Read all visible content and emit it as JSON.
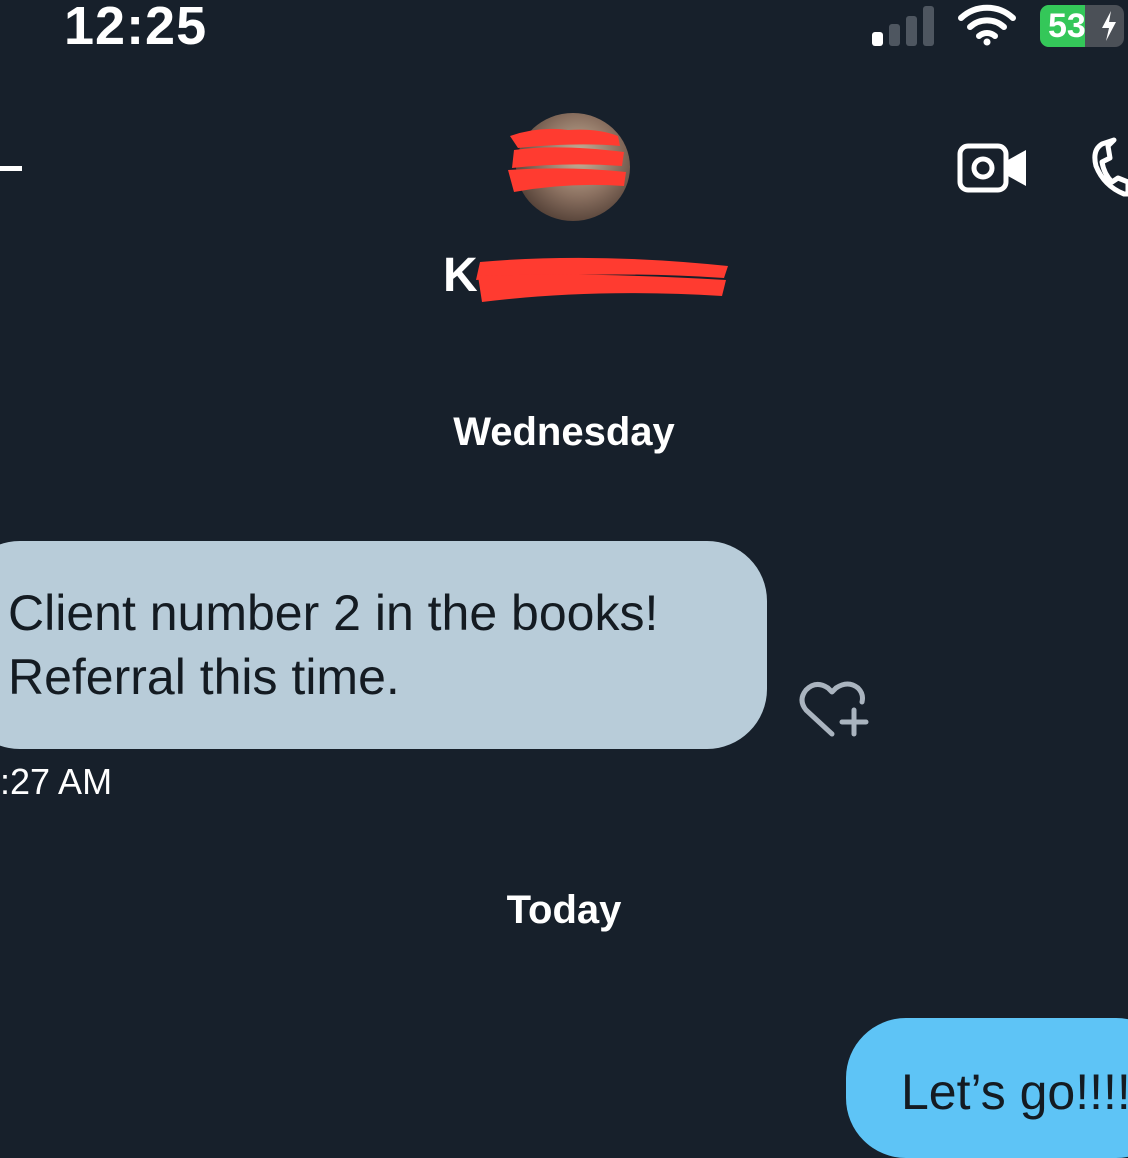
{
  "status_bar": {
    "time": "12:25",
    "battery_percent": "53",
    "signal_strength": 0.25,
    "icons": [
      "signal-icon",
      "wifi-icon",
      "battery-charging-icon"
    ]
  },
  "header": {
    "contact_name_visible": "K",
    "icons": [
      "back-arrow-icon",
      "video-call-icon",
      "phone-call-icon"
    ]
  },
  "conversation": {
    "date_separators": [
      "Wednesday",
      "Today"
    ],
    "messages": [
      {
        "direction": "incoming",
        "lines": [
          "Client number 2 in the books!",
          "Referral this time."
        ],
        "time": ":27 AM"
      },
      {
        "direction": "outgoing",
        "text": "Let’s go!!!!"
      }
    ],
    "reaction_icon": "heart-plus-icon"
  },
  "colors": {
    "background": "#17202b",
    "incoming_bubble": "#b8ccd9",
    "outgoing_bubble": "#5ec4f6",
    "redaction": "#ff3b30",
    "battery_fill": "#34c759"
  }
}
